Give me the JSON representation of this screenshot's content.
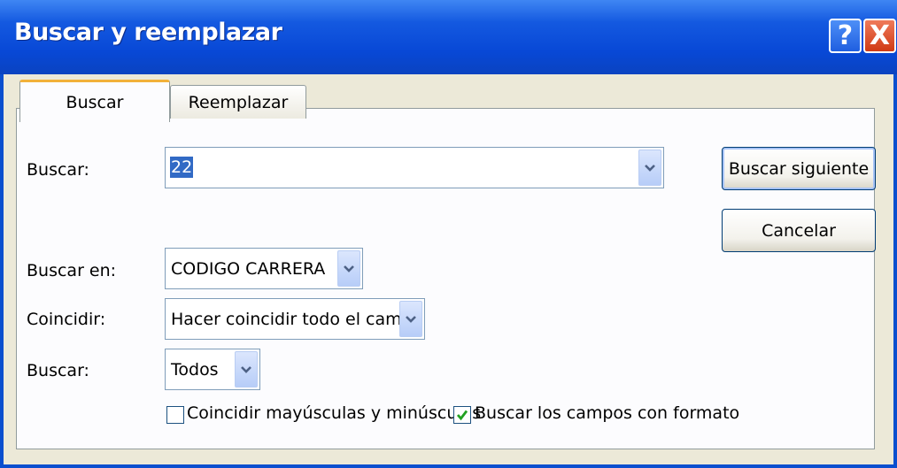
{
  "window": {
    "title": "Buscar y reemplazar",
    "help_glyph": "?",
    "close_glyph": "X"
  },
  "tabs": [
    {
      "label": "Buscar",
      "active": true
    },
    {
      "label": "Reemplazar",
      "active": false
    }
  ],
  "form": {
    "find_label": "Buscar:",
    "find_value": "22",
    "look_in_label": "Buscar en:",
    "look_in_value": "CODIGO CARRERA",
    "match_label": "Coincidir:",
    "match_value": "Hacer coincidir todo el campo",
    "search_label": "Buscar:",
    "search_value": "Todos",
    "match_case_label": "Coincidir mayúsculas y minúsculas",
    "match_case_checked": false,
    "search_formatted_label": "Buscar los campos con formato",
    "search_formatted_checked": true
  },
  "buttons": {
    "find_next": "Buscar siguiente",
    "cancel": "Cancelar"
  },
  "icons": {
    "help": "help-icon",
    "close": "close-icon",
    "dropdown": "chevron-down-icon",
    "checkmark": "checkmark-icon"
  },
  "colors": {
    "titlebar": "#0a4fcf",
    "selection": "#316ac5",
    "active_tab_accent": "#f2b13a",
    "check_green": "#21a121"
  }
}
